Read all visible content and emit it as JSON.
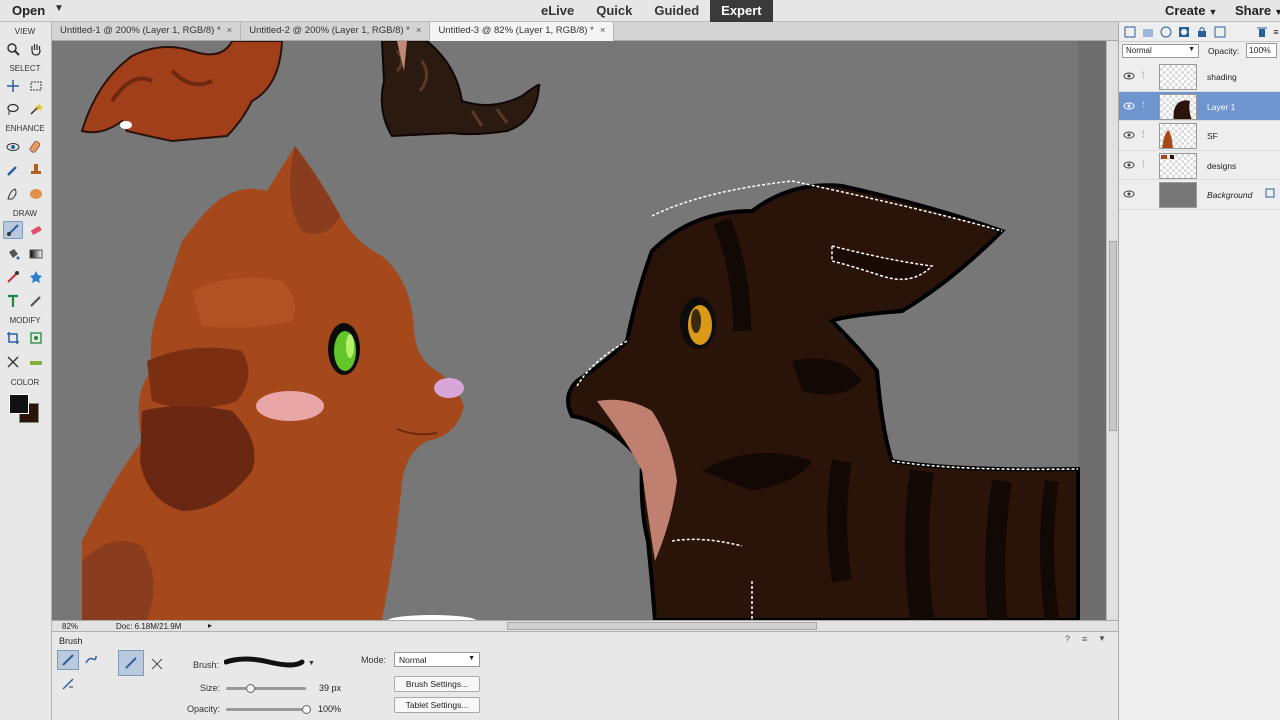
{
  "topbar": {
    "open_label": "Open",
    "modes": [
      "eLive",
      "Quick",
      "Guided",
      "Expert"
    ],
    "active_mode": "Expert",
    "create_label": "Create",
    "share_label": "Share"
  },
  "tabs": [
    {
      "label": "Untitled-1 @ 200% (Layer 1, RGB/8) *",
      "active": false
    },
    {
      "label": "Untitled-2 @ 200% (Layer 1, RGB/8) *",
      "active": false
    },
    {
      "label": "Untitled-3 @ 82% (Layer 1, RGB/8) *",
      "active": true
    }
  ],
  "toolbox": {
    "sections": {
      "view": "VIEW",
      "select": "SELECT",
      "enhance": "ENHANCE",
      "draw": "DRAW",
      "modify": "MODIFY",
      "color": "COLOR"
    },
    "foreground_color": "#111111",
    "background_color": "#2b1408"
  },
  "status": {
    "zoom": "82%",
    "doc": "Doc: 6.18M/21.9M"
  },
  "tool_options": {
    "title": "Brush",
    "brush_label": "Brush:",
    "size_label": "Size:",
    "size_value": "39 px",
    "size_fraction": 0.3,
    "opacity_label": "Opacity:",
    "opacity_value": "100%",
    "opacity_fraction": 1.0,
    "mode_label": "Mode:",
    "mode_value": "Normal",
    "brush_settings": "Brush Settings...",
    "tablet_settings": "Tablet Settings..."
  },
  "layers_panel": {
    "blend_mode": "Normal",
    "opacity_label": "Opacity:",
    "opacity_value": "100%",
    "layers": [
      {
        "name": "shading",
        "selected": false,
        "italic": false
      },
      {
        "name": "Layer 1",
        "selected": true,
        "italic": false
      },
      {
        "name": "SF",
        "selected": false,
        "italic": false
      },
      {
        "name": "designs",
        "selected": false,
        "italic": false
      },
      {
        "name": "Background",
        "selected": false,
        "italic": true
      }
    ]
  },
  "colors": {
    "canvas_gray": "#777777",
    "orange_cat": "#a5481c",
    "brown_cat": "#2a140a",
    "selection_accent": "#6f95cf"
  }
}
